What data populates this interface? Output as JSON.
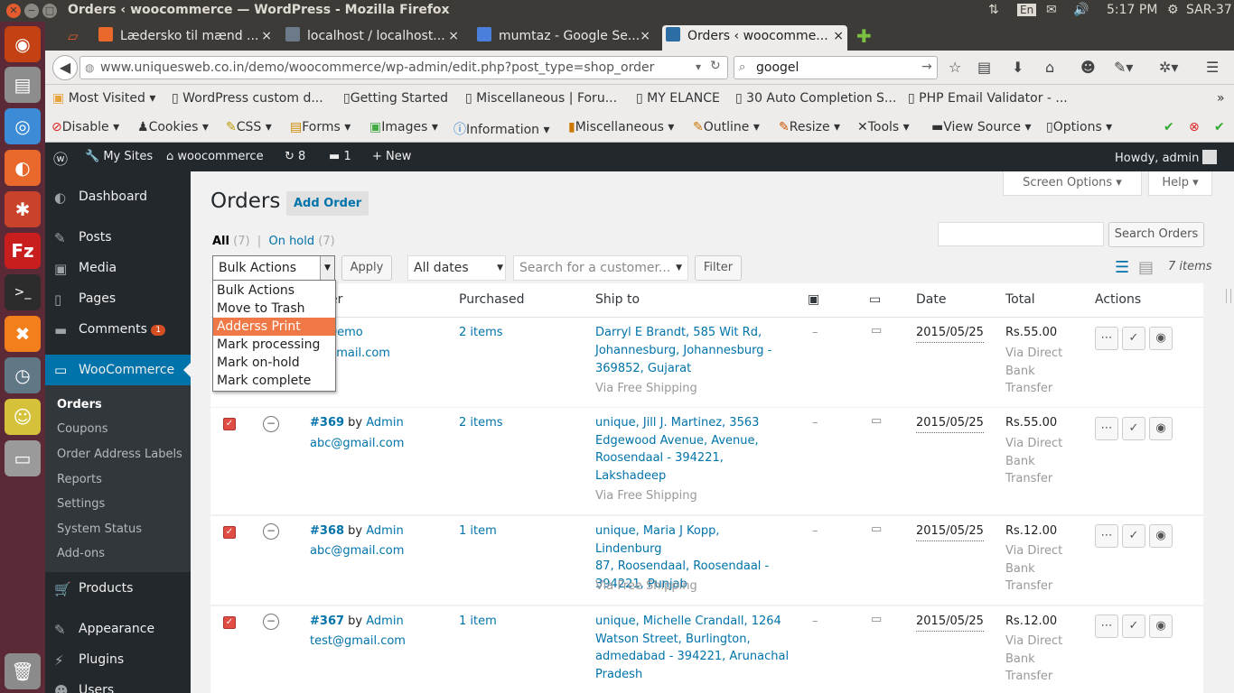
{
  "window": {
    "title": "Orders ‹ woocommerce — WordPress - Mozilla Firefox"
  },
  "tray": {
    "keyboard": "En",
    "time": "5:17 PM",
    "user": "SAR-37"
  },
  "tabs": [
    {
      "label": "Lædersko til mænd ...",
      "active": false
    },
    {
      "label": "localhost / localhost...",
      "active": false
    },
    {
      "label": "mumtaz - Google Se...",
      "active": false
    },
    {
      "label": "Orders ‹ woocomme...",
      "active": true
    }
  ],
  "nav": {
    "url": "www.uniquesweb.co.in/demo/woocommerce/wp-admin/edit.php?post_type=shop_order",
    "search": "googel"
  },
  "bookmarks": [
    "Most Visited ▾",
    "WordPress custom d...",
    "Getting Started",
    "Miscellaneous | Foru...",
    "MY ELANCE",
    "30 Auto Completion S...",
    "PHP Email Validator - ..."
  ],
  "webdev": [
    "Disable ▾",
    "Cookies ▾",
    "CSS ▾",
    "Forms ▾",
    "Images ▾",
    "Information ▾",
    "Miscellaneous ▾",
    "Outline ▾",
    "Resize ▾",
    "Tools ▾",
    "View Source ▾",
    "Options ▾"
  ],
  "adminbar": {
    "my_sites": "My Sites",
    "site": "woocommerce",
    "updates": "8",
    "comments": "1",
    "new": "New",
    "howdy": "Howdy, admin"
  },
  "menu": {
    "dashboard": "Dashboard",
    "posts": "Posts",
    "media": "Media",
    "pages": "Pages",
    "comments": "Comments",
    "comments_count": "1",
    "woocommerce": "WooCommerce",
    "submenu": [
      "Orders",
      "Coupons",
      "Order Address Labels",
      "Reports",
      "Settings",
      "System Status",
      "Add-ons"
    ],
    "products": "Products",
    "appearance": "Appearance",
    "plugins": "Plugins",
    "users": "Users"
  },
  "page": {
    "title": "Orders",
    "add_order": "Add Order",
    "screen_options": "Screen Options ▾",
    "help": "Help ▾",
    "filter_all": "All",
    "filter_all_count": "(7)",
    "filter_onhold": "On hold",
    "filter_onhold_count": "(7)",
    "search_button": "Search Orders",
    "bulk_label": "Bulk Actions",
    "apply": "Apply",
    "dates": "All dates",
    "customer_placeholder": "Search for a customer...",
    "filter": "Filter",
    "items_count": "7 items"
  },
  "bulk_options": [
    "Bulk Actions",
    "Move to Trash",
    "Adderss Print",
    "Mark processing",
    "Mark on-hold",
    "Mark complete"
  ],
  "columns": {
    "order": "er",
    "purchased": "Purchased",
    "ship_to": "Ship to",
    "date": "Date",
    "total": "Total",
    "actions": "Actions"
  },
  "orders": [
    {
      "id": "",
      "by": "by",
      "customer": "Demo",
      "email": "o@gmail.com",
      "purchased": "2 items",
      "ship": [
        "Darryl E Brandt, 585 Wit Rd,",
        "Johannesburg, Johannesburg -",
        "369852, Gujarat"
      ],
      "via": "Via Free Shipping",
      "notes": "–",
      "date": "2015/05/25",
      "total": "Rs.55.00",
      "method": [
        "Via Direct",
        "Bank",
        "Transfer"
      ]
    },
    {
      "id": "#369",
      "by": "by",
      "customer": "Admin",
      "email": "abc@gmail.com",
      "purchased": "2 items",
      "ship": [
        "unique, Jill J. Martinez, 3563",
        "Edgewood Avenue, Avenue,",
        "Roosendaal - 394221,",
        "Lakshadeep"
      ],
      "via": "Via Free Shipping",
      "notes": "–",
      "date": "2015/05/25",
      "total": "Rs.55.00",
      "method": [
        "Via Direct",
        "Bank",
        "Transfer"
      ]
    },
    {
      "id": "#368",
      "by": "by",
      "customer": "Admin",
      "email": "abc@gmail.com",
      "purchased": "1 item",
      "ship": [
        "unique, Maria J Kopp, Lindenburg",
        "87, Roosendaal, Roosendaal -",
        "394221, Punjab"
      ],
      "via": "Via Free Shipping",
      "notes": "–",
      "date": "2015/05/25",
      "total": "Rs.12.00",
      "method": [
        "Via Direct",
        "Bank",
        "Transfer"
      ]
    },
    {
      "id": "#367",
      "by": "by",
      "customer": "Admin",
      "email": "test@gmail.com",
      "purchased": "1 item",
      "ship": [
        "unique, Michelle Crandall, 1264",
        "Watson Street, Burlington,",
        "admedabad - 394221, Arunachal",
        "Pradesh"
      ],
      "via": "Via Free Shipping",
      "notes": "–",
      "date": "2015/05/25",
      "total": "Rs.12.00",
      "method": [
        "Via Direct",
        "Bank",
        "Transfer"
      ]
    }
  ]
}
